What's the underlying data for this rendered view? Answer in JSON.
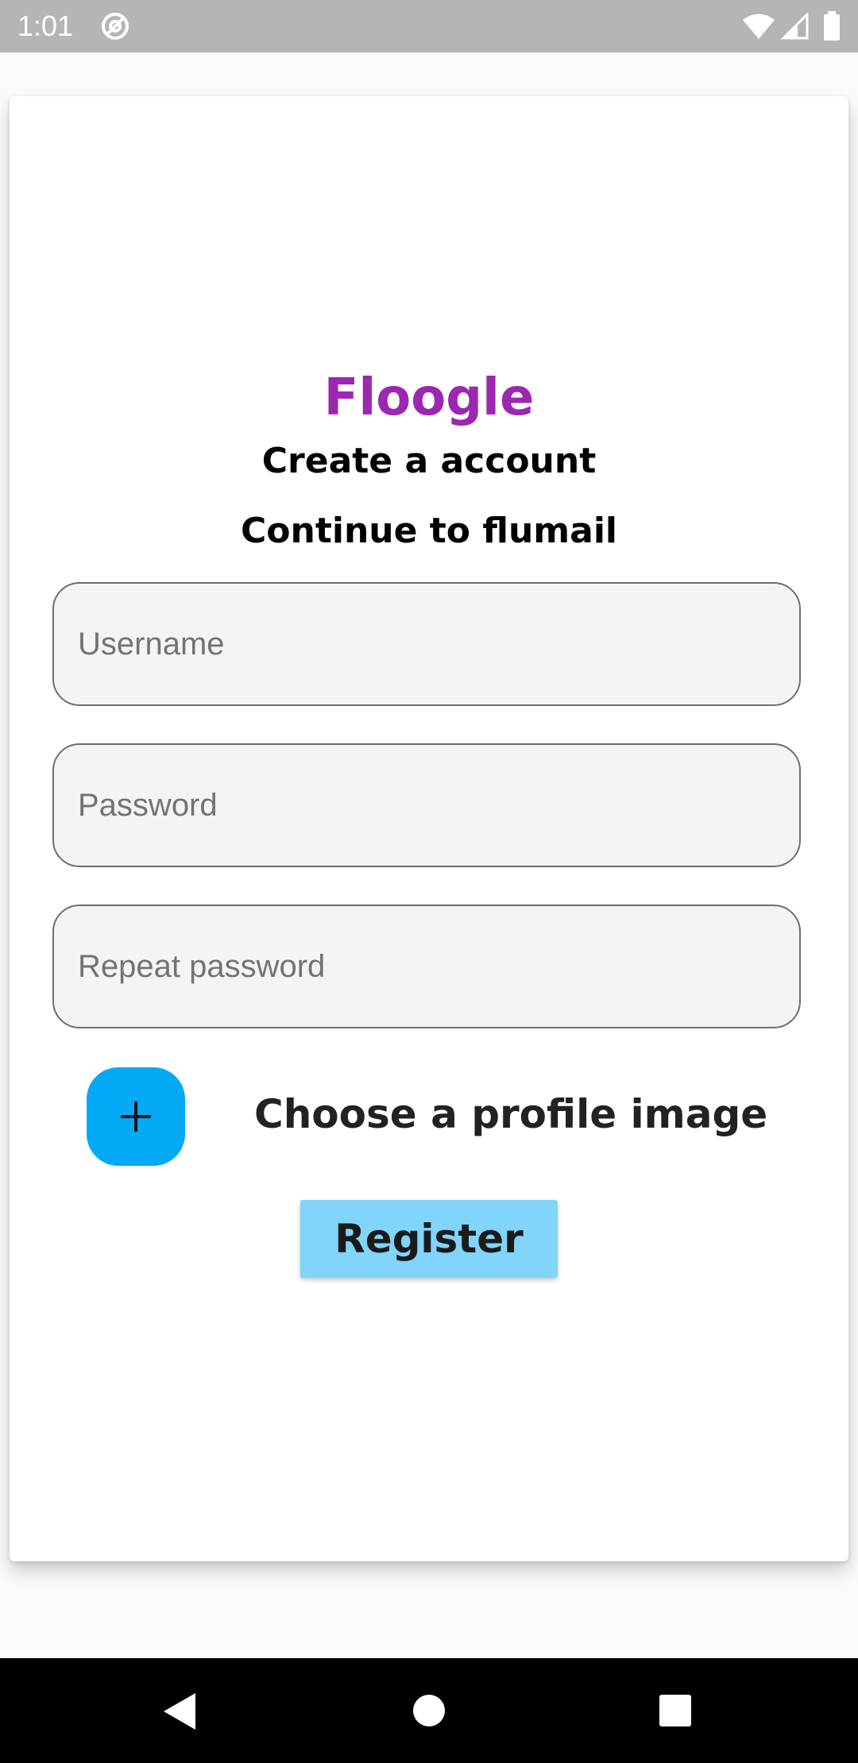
{
  "status_bar": {
    "time": "1:01",
    "icons": [
      "sync-icon",
      "wifi-icon",
      "signal-icon",
      "battery-icon"
    ]
  },
  "brand": {
    "title": "Floogle",
    "color": "#9c27b0"
  },
  "headings": {
    "create": "Create a account",
    "continue": "Continue to flumail"
  },
  "form": {
    "username": {
      "placeholder": "Username",
      "value": ""
    },
    "password": {
      "placeholder": "Password",
      "value": ""
    },
    "repeat_password": {
      "placeholder": "Repeat password",
      "value": ""
    }
  },
  "profile_image": {
    "label": "Choose a profile image",
    "button_icon": "plus-icon",
    "button_color": "#03a9f4"
  },
  "register": {
    "label": "Register",
    "color": "#81d4fa"
  },
  "nav_bar": {
    "icons": [
      "back-icon",
      "home-icon",
      "recents-icon"
    ]
  }
}
